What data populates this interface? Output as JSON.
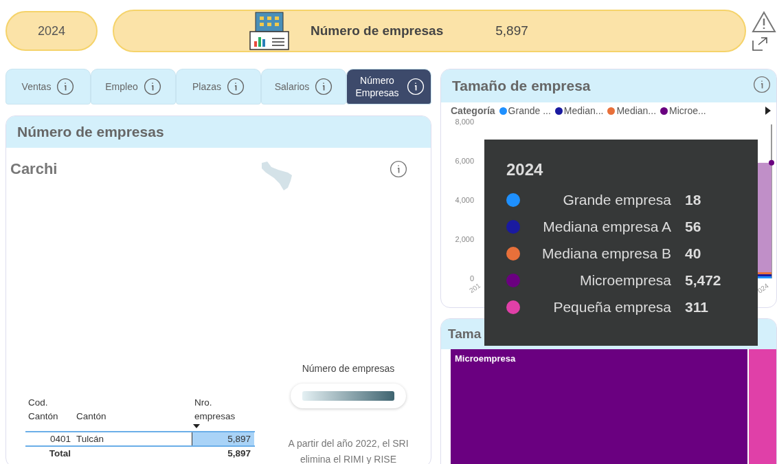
{
  "year_filter": {
    "value": "2024"
  },
  "banner": {
    "title": "Número de empresas",
    "value": "5,897"
  },
  "tabs": [
    {
      "label": "Ventas",
      "selected": false
    },
    {
      "label": "Empleo",
      "selected": false
    },
    {
      "label": "Plazas",
      "selected": false
    },
    {
      "label": "Salarios",
      "selected": false
    },
    {
      "label": "Número Empresas",
      "selected": true
    }
  ],
  "map_card": {
    "title": "Número de empresas",
    "region": "Carchi",
    "table": {
      "columns": [
        "Cod. Cantón",
        "Cantón",
        "Nro. empresas"
      ],
      "rows": [
        {
          "cells": [
            "0401",
            "Tulcán",
            "5,897"
          ],
          "level": 1
        }
      ],
      "total": {
        "label": "Total",
        "value": "5,897"
      }
    },
    "legend": {
      "title": "Número de empresas"
    },
    "note": "A partir del año 2022, el SRI elimina el RIMI y RISE"
  },
  "size_chart_card": {
    "title": "Tamaño de empresa",
    "legend_title": "Categoría",
    "chart_data": {
      "type": "area",
      "stacked": true,
      "categories": [
        "201",
        "024"
      ],
      "ylim": [
        0,
        8000
      ],
      "yticks": [
        0,
        {
          "value": 2000,
          "label": "2,000"
        },
        {
          "value": 4000,
          "label": "4,000"
        },
        {
          "value": 6000,
          "label": "6,000"
        },
        {
          "value": 8000,
          "label": "8,000"
        }
      ],
      "series": [
        {
          "name": "Grande ...",
          "color": "#1e90ff",
          "values": [
            null,
            null
          ]
        },
        {
          "name": "Median...",
          "color": "#1a1aa0",
          "values": [
            null,
            null
          ]
        },
        {
          "name": "Median...",
          "color": "#e8703a",
          "values": [
            null,
            null
          ]
        },
        {
          "name": "Microe...",
          "color": "#6a0080",
          "values": [
            null,
            null
          ]
        }
      ]
    }
  },
  "tooltip": {
    "title": "2024",
    "items": [
      {
        "label": "Grande empresa",
        "value": "18",
        "color": "#1e90ff"
      },
      {
        "label": "Mediana empresa A",
        "value": "56",
        "color": "#1a1aa0"
      },
      {
        "label": "Mediana empresa B",
        "value": "40",
        "color": "#e8703a"
      },
      {
        "label": "Microempresa",
        "value": "5,472",
        "color": "#6a0080"
      },
      {
        "label": "Pequeña empresa",
        "value": "311",
        "color": "#e040a8"
      }
    ]
  },
  "treemap_card": {
    "title": "Tama",
    "tiles": [
      {
        "label": "Microempresa",
        "color": "#6a0080"
      },
      {
        "color": "#e040a8"
      }
    ]
  }
}
